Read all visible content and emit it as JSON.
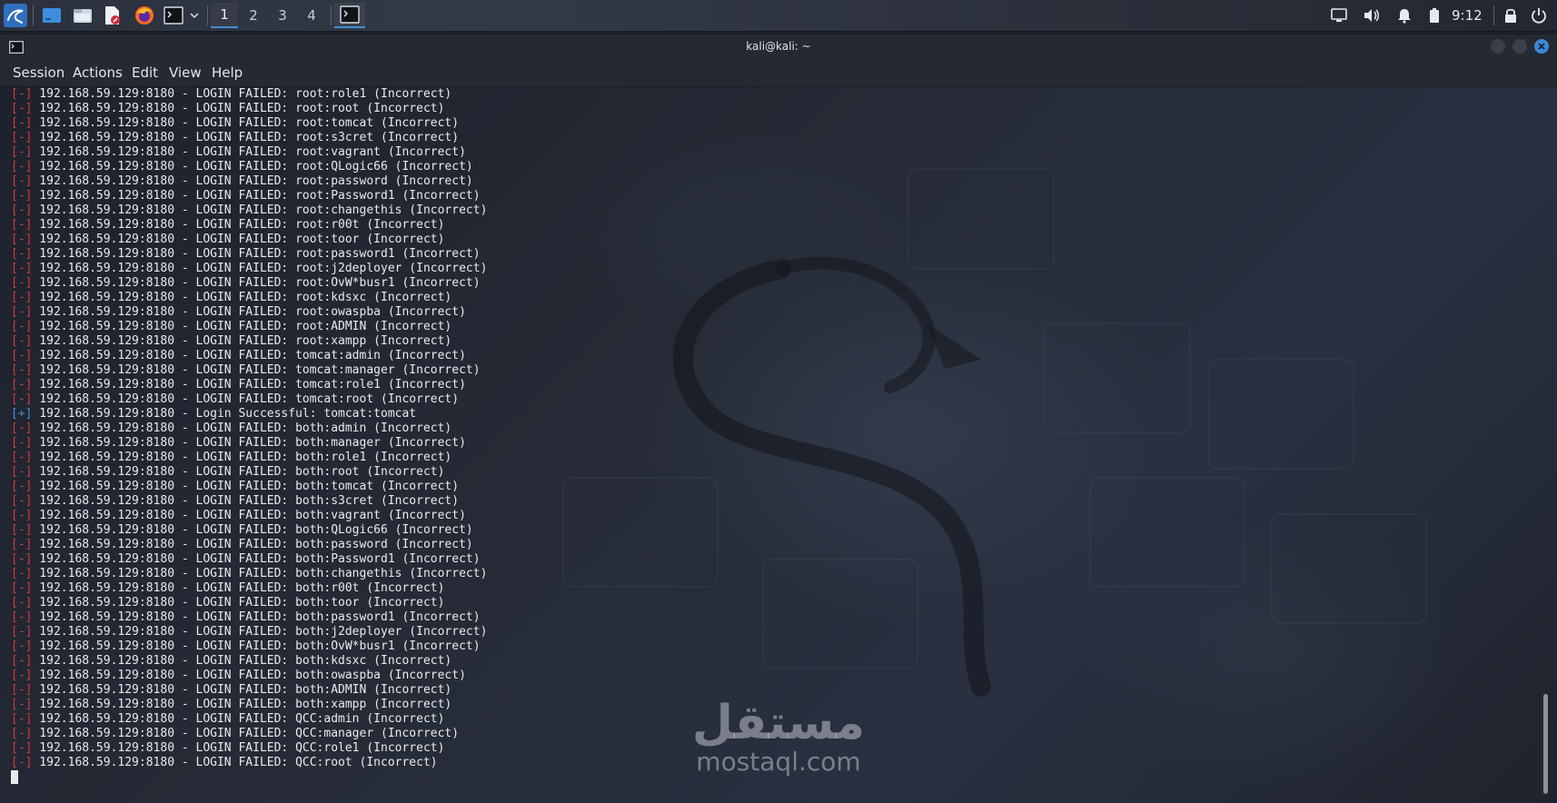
{
  "panel": {
    "icons": [
      "kali-menu-icon",
      "show-desktop-icon",
      "file-manager-icon",
      "text-editor-icon",
      "firefox-icon",
      "terminal-icon",
      "chevron-down-icon"
    ],
    "workspaces": [
      "1",
      "2",
      "3",
      "4"
    ],
    "active_workspace": "1",
    "tray_icons": [
      "display-icon",
      "volume-icon",
      "bell-icon",
      "battery-icon",
      "lock-icon",
      "power-icon"
    ],
    "clock": "9:12"
  },
  "window": {
    "title": "kali@kali: ~",
    "menu": [
      "Session",
      "Actions",
      "Edit",
      "View",
      "Help"
    ]
  },
  "terminal": {
    "lines": [
      {
        "marker": "[-]",
        "text": " 192.168.59.129:8180 - LOGIN FAILED: root:role1 (Incorrect)"
      },
      {
        "marker": "[-]",
        "text": " 192.168.59.129:8180 - LOGIN FAILED: root:root (Incorrect)"
      },
      {
        "marker": "[-]",
        "text": " 192.168.59.129:8180 - LOGIN FAILED: root:tomcat (Incorrect)"
      },
      {
        "marker": "[-]",
        "text": " 192.168.59.129:8180 - LOGIN FAILED: root:s3cret (Incorrect)"
      },
      {
        "marker": "[-]",
        "text": " 192.168.59.129:8180 - LOGIN FAILED: root:vagrant (Incorrect)"
      },
      {
        "marker": "[-]",
        "text": " 192.168.59.129:8180 - LOGIN FAILED: root:QLogic66 (Incorrect)"
      },
      {
        "marker": "[-]",
        "text": " 192.168.59.129:8180 - LOGIN FAILED: root:password (Incorrect)"
      },
      {
        "marker": "[-]",
        "text": " 192.168.59.129:8180 - LOGIN FAILED: root:Password1 (Incorrect)"
      },
      {
        "marker": "[-]",
        "text": " 192.168.59.129:8180 - LOGIN FAILED: root:changethis (Incorrect)"
      },
      {
        "marker": "[-]",
        "text": " 192.168.59.129:8180 - LOGIN FAILED: root:r00t (Incorrect)"
      },
      {
        "marker": "[-]",
        "text": " 192.168.59.129:8180 - LOGIN FAILED: root:toor (Incorrect)"
      },
      {
        "marker": "[-]",
        "text": " 192.168.59.129:8180 - LOGIN FAILED: root:password1 (Incorrect)"
      },
      {
        "marker": "[-]",
        "text": " 192.168.59.129:8180 - LOGIN FAILED: root:j2deployer (Incorrect)"
      },
      {
        "marker": "[-]",
        "text": " 192.168.59.129:8180 - LOGIN FAILED: root:OvW*busr1 (Incorrect)"
      },
      {
        "marker": "[-]",
        "text": " 192.168.59.129:8180 - LOGIN FAILED: root:kdsxc (Incorrect)"
      },
      {
        "marker": "[-]",
        "text": " 192.168.59.129:8180 - LOGIN FAILED: root:owaspba (Incorrect)"
      },
      {
        "marker": "[-]",
        "text": " 192.168.59.129:8180 - LOGIN FAILED: root:ADMIN (Incorrect)"
      },
      {
        "marker": "[-]",
        "text": " 192.168.59.129:8180 - LOGIN FAILED: root:xampp (Incorrect)"
      },
      {
        "marker": "[-]",
        "text": " 192.168.59.129:8180 - LOGIN FAILED: tomcat:admin (Incorrect)"
      },
      {
        "marker": "[-]",
        "text": " 192.168.59.129:8180 - LOGIN FAILED: tomcat:manager (Incorrect)"
      },
      {
        "marker": "[-]",
        "text": " 192.168.59.129:8180 - LOGIN FAILED: tomcat:role1 (Incorrect)"
      },
      {
        "marker": "[-]",
        "text": " 192.168.59.129:8180 - LOGIN FAILED: tomcat:root (Incorrect)"
      },
      {
        "marker": "[+]",
        "text": " 192.168.59.129:8180 - Login Successful: tomcat:tomcat"
      },
      {
        "marker": "[-]",
        "text": " 192.168.59.129:8180 - LOGIN FAILED: both:admin (Incorrect)"
      },
      {
        "marker": "[-]",
        "text": " 192.168.59.129:8180 - LOGIN FAILED: both:manager (Incorrect)"
      },
      {
        "marker": "[-]",
        "text": " 192.168.59.129:8180 - LOGIN FAILED: both:role1 (Incorrect)"
      },
      {
        "marker": "[-]",
        "text": " 192.168.59.129:8180 - LOGIN FAILED: both:root (Incorrect)"
      },
      {
        "marker": "[-]",
        "text": " 192.168.59.129:8180 - LOGIN FAILED: both:tomcat (Incorrect)"
      },
      {
        "marker": "[-]",
        "text": " 192.168.59.129:8180 - LOGIN FAILED: both:s3cret (Incorrect)"
      },
      {
        "marker": "[-]",
        "text": " 192.168.59.129:8180 - LOGIN FAILED: both:vagrant (Incorrect)"
      },
      {
        "marker": "[-]",
        "text": " 192.168.59.129:8180 - LOGIN FAILED: both:QLogic66 (Incorrect)"
      },
      {
        "marker": "[-]",
        "text": " 192.168.59.129:8180 - LOGIN FAILED: both:password (Incorrect)"
      },
      {
        "marker": "[-]",
        "text": " 192.168.59.129:8180 - LOGIN FAILED: both:Password1 (Incorrect)"
      },
      {
        "marker": "[-]",
        "text": " 192.168.59.129:8180 - LOGIN FAILED: both:changethis (Incorrect)"
      },
      {
        "marker": "[-]",
        "text": " 192.168.59.129:8180 - LOGIN FAILED: both:r00t (Incorrect)"
      },
      {
        "marker": "[-]",
        "text": " 192.168.59.129:8180 - LOGIN FAILED: both:toor (Incorrect)"
      },
      {
        "marker": "[-]",
        "text": " 192.168.59.129:8180 - LOGIN FAILED: both:password1 (Incorrect)"
      },
      {
        "marker": "[-]",
        "text": " 192.168.59.129:8180 - LOGIN FAILED: both:j2deployer (Incorrect)"
      },
      {
        "marker": "[-]",
        "text": " 192.168.59.129:8180 - LOGIN FAILED: both:OvW*busr1 (Incorrect)"
      },
      {
        "marker": "[-]",
        "text": " 192.168.59.129:8180 - LOGIN FAILED: both:kdsxc (Incorrect)"
      },
      {
        "marker": "[-]",
        "text": " 192.168.59.129:8180 - LOGIN FAILED: both:owaspba (Incorrect)"
      },
      {
        "marker": "[-]",
        "text": " 192.168.59.129:8180 - LOGIN FAILED: both:ADMIN (Incorrect)"
      },
      {
        "marker": "[-]",
        "text": " 192.168.59.129:8180 - LOGIN FAILED: both:xampp (Incorrect)"
      },
      {
        "marker": "[-]",
        "text": " 192.168.59.129:8180 - LOGIN FAILED: QCC:admin (Incorrect)"
      },
      {
        "marker": "[-]",
        "text": " 192.168.59.129:8180 - LOGIN FAILED: QCC:manager (Incorrect)"
      },
      {
        "marker": "[-]",
        "text": " 192.168.59.129:8180 - LOGIN FAILED: QCC:role1 (Incorrect)"
      },
      {
        "marker": "[-]",
        "text": " 192.168.59.129:8180 - LOGIN FAILED: QCC:root (Incorrect)"
      }
    ]
  },
  "watermark": {
    "arabic": "مستقل",
    "latin": "mostaql.com"
  },
  "colors": {
    "fail_marker": "#d33b3b",
    "success_marker": "#4f8fd8",
    "accent": "#3e8fd6"
  }
}
